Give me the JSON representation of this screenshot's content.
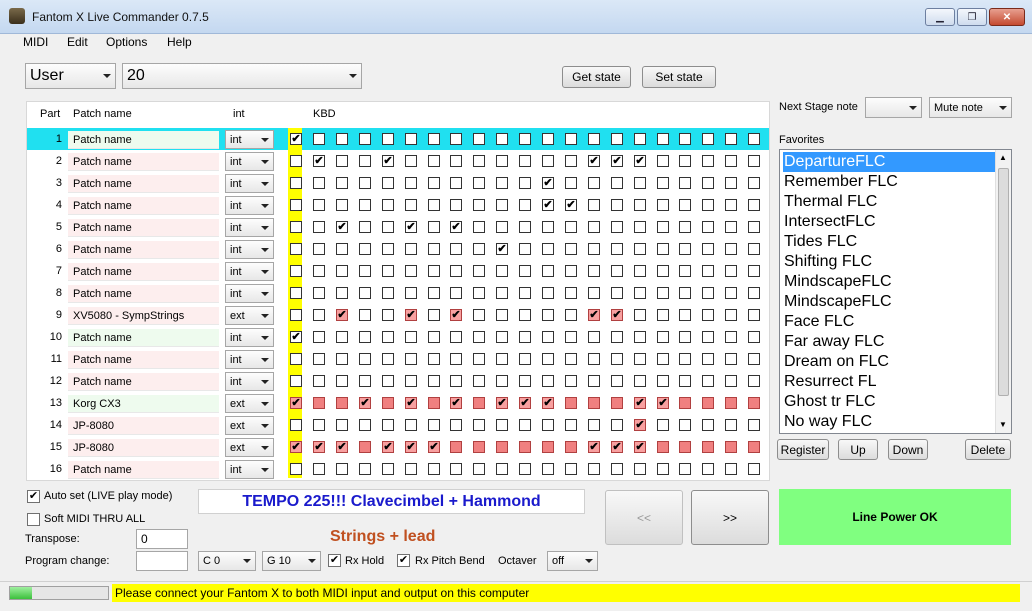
{
  "window": {
    "title": "Fantom X Live Commander 0.7.5",
    "min": "▁",
    "max": "❐",
    "close": "✕"
  },
  "menu": [
    "MIDI",
    "Edit",
    "Options",
    "Help"
  ],
  "top": {
    "bank": "User",
    "patch": "20",
    "get_state": "Get state",
    "set_state": "Set state"
  },
  "headers": {
    "part": "Part",
    "patch_name": "Patch name",
    "int": "int",
    "kbd": "KBD"
  },
  "rows": [
    {
      "num": "1",
      "name": "Patch name",
      "color": "g",
      "mode": "int",
      "first": true,
      "keys": [
        0,
        0,
        0,
        0,
        0,
        0,
        0,
        0,
        0,
        0,
        0,
        0,
        0,
        0,
        0,
        0,
        0,
        0,
        0,
        0
      ],
      "style": ""
    },
    {
      "num": "2",
      "name": "Patch name",
      "color": "p",
      "mode": "int",
      "first": false,
      "keys": [
        1,
        0,
        0,
        1,
        0,
        0,
        0,
        0,
        0,
        0,
        0,
        0,
        1,
        1,
        1,
        0,
        0,
        0,
        0,
        0
      ],
      "style": ""
    },
    {
      "num": "3",
      "name": "Patch name",
      "color": "p",
      "mode": "int",
      "first": false,
      "keys": [
        0,
        0,
        0,
        0,
        0,
        0,
        0,
        0,
        0,
        0,
        1,
        0,
        0,
        0,
        0,
        0,
        0,
        0,
        0,
        0
      ],
      "style": ""
    },
    {
      "num": "4",
      "name": "Patch name",
      "color": "p",
      "mode": "int",
      "first": false,
      "keys": [
        0,
        0,
        0,
        0,
        0,
        0,
        0,
        0,
        0,
        0,
        1,
        1,
        0,
        0,
        0,
        0,
        0,
        0,
        0,
        0
      ],
      "style": ""
    },
    {
      "num": "5",
      "name": "Patch name",
      "color": "p",
      "mode": "int",
      "first": false,
      "keys": [
        0,
        1,
        0,
        0,
        1,
        0,
        1,
        0,
        0,
        0,
        0,
        0,
        0,
        0,
        0,
        0,
        0,
        0,
        0,
        0
      ],
      "style": ""
    },
    {
      "num": "6",
      "name": "Patch name",
      "color": "p",
      "mode": "int",
      "first": false,
      "keys": [
        0,
        0,
        0,
        0,
        0,
        0,
        0,
        0,
        1,
        0,
        0,
        0,
        0,
        0,
        0,
        0,
        0,
        0,
        0,
        0
      ],
      "style": ""
    },
    {
      "num": "7",
      "name": "Patch name",
      "color": "p",
      "mode": "int",
      "first": false,
      "keys": [
        0,
        0,
        0,
        0,
        0,
        0,
        0,
        0,
        0,
        0,
        0,
        0,
        0,
        0,
        0,
        0,
        0,
        0,
        0,
        0
      ],
      "style": ""
    },
    {
      "num": "8",
      "name": "Patch name",
      "color": "p",
      "mode": "int",
      "first": false,
      "keys": [
        0,
        0,
        0,
        0,
        0,
        0,
        0,
        0,
        0,
        0,
        0,
        0,
        0,
        0,
        0,
        0,
        0,
        0,
        0,
        0
      ],
      "style": ""
    },
    {
      "num": "9",
      "name": "XV5080 - SympStrings",
      "color": "p",
      "mode": "ext",
      "first": false,
      "keys": [
        0,
        2,
        0,
        0,
        2,
        0,
        2,
        0,
        0,
        0,
        0,
        0,
        2,
        2,
        0,
        0,
        0,
        0,
        0,
        0
      ],
      "style": "red"
    },
    {
      "num": "10",
      "name": "Patch name",
      "color": "g",
      "mode": "int",
      "first": true,
      "keys": [
        0,
        0,
        0,
        0,
        0,
        0,
        0,
        0,
        0,
        0,
        0,
        0,
        0,
        0,
        0,
        0,
        0,
        0,
        0,
        0
      ],
      "style": ""
    },
    {
      "num": "11",
      "name": "Patch name",
      "color": "p",
      "mode": "int",
      "first": false,
      "keys": [
        0,
        0,
        0,
        0,
        0,
        0,
        0,
        0,
        0,
        0,
        0,
        0,
        0,
        0,
        0,
        0,
        0,
        0,
        0,
        0
      ],
      "style": ""
    },
    {
      "num": "12",
      "name": "Patch name",
      "color": "p",
      "mode": "int",
      "first": false,
      "keys": [
        0,
        0,
        0,
        0,
        0,
        0,
        0,
        0,
        0,
        0,
        0,
        0,
        0,
        0,
        0,
        0,
        0,
        0,
        0,
        0
      ],
      "style": ""
    },
    {
      "num": "13",
      "name": "Korg CX3",
      "color": "g",
      "mode": "ext",
      "first": "red",
      "keys": [
        3,
        3,
        2,
        3,
        2,
        3,
        2,
        3,
        2,
        2,
        2,
        3,
        3,
        3,
        2,
        2,
        3,
        3,
        3,
        3
      ],
      "style": "red"
    },
    {
      "num": "14",
      "name": "JP-8080",
      "color": "p",
      "mode": "ext",
      "first": false,
      "keys": [
        0,
        0,
        0,
        0,
        0,
        0,
        0,
        0,
        0,
        0,
        0,
        0,
        0,
        0,
        2,
        0,
        0,
        0,
        0,
        0
      ],
      "style": "red"
    },
    {
      "num": "15",
      "name": "JP-8080",
      "color": "p",
      "mode": "ext",
      "first": "red",
      "keys": [
        2,
        2,
        3,
        2,
        2,
        2,
        3,
        3,
        3,
        3,
        3,
        3,
        2,
        2,
        2,
        3,
        3,
        3,
        3,
        3
      ],
      "style": "red"
    },
    {
      "num": "16",
      "name": "Patch name",
      "color": "p",
      "mode": "int",
      "first": false,
      "keys": [
        0,
        0,
        0,
        0,
        0,
        0,
        0,
        0,
        0,
        0,
        0,
        0,
        0,
        0,
        0,
        0,
        0,
        0,
        0,
        0
      ],
      "style": ""
    }
  ],
  "right": {
    "next_stage_label": "Next Stage note",
    "next_stage_value": "",
    "mute_note": "Mute note",
    "favorites_label": "Favorites",
    "favorites": [
      "DepartureFLC",
      "Remember FLC",
      "Thermal FLC",
      "IntersectFLC",
      "Tides FLC",
      "Shifting FLC",
      "MindscapeFLC",
      "MindscapeFLC",
      "Face FLC",
      "Far away FLC",
      "Dream on FLC",
      "Resurrect FL",
      "Ghost tr FLC",
      "No way  FLC"
    ],
    "register": "Register",
    "up": "Up",
    "down": "Down",
    "delete": "Delete"
  },
  "bottom": {
    "auto_set": "Auto set (LIVE play mode)",
    "soft_thru": "Soft MIDI THRU ALL",
    "transpose_label": "Transpose:",
    "transpose_value": "0",
    "program_change_label": "Program change:",
    "program_change_value": "",
    "tempo": "TEMPO 225!!!    Clavecimbel + Hammond",
    "strings": "Strings + lead",
    "prev": "<<",
    "next": ">>",
    "line_power": "Line Power OK",
    "c_sel": "C  0",
    "g_sel": "G  10",
    "rx_hold": "Rx Hold",
    "rx_pitch": "Rx Pitch Bend",
    "octaver_label": "Octaver",
    "octaver_value": "off"
  },
  "status": {
    "message": "Please connect your Fantom X to both MIDI input and output on this computer",
    "progress": 0.22
  }
}
